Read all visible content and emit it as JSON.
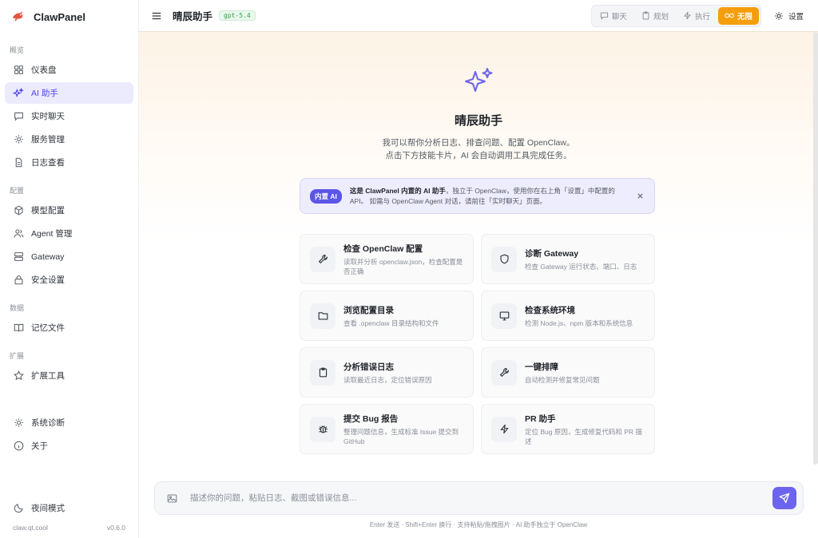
{
  "app": {
    "name": "ClawPanel",
    "version": "v0.6.0",
    "domain": "claw.qt.cool"
  },
  "sidebar": {
    "sections": [
      {
        "title": "概览",
        "items": [
          {
            "label": "仪表盘",
            "icon": "grid-icon"
          },
          {
            "label": "AI 助手",
            "icon": "sparkle-icon",
            "active": true
          },
          {
            "label": "实时聊天",
            "icon": "chat-icon"
          },
          {
            "label": "服务管理",
            "icon": "gear-icon"
          },
          {
            "label": "日志查看",
            "icon": "document-icon"
          }
        ]
      },
      {
        "title": "配置",
        "items": [
          {
            "label": "模型配置",
            "icon": "cube-icon"
          },
          {
            "label": "Agent 管理",
            "icon": "users-icon"
          },
          {
            "label": "Gateway",
            "icon": "server-icon"
          },
          {
            "label": "安全设置",
            "icon": "lock-icon"
          }
        ]
      },
      {
        "title": "数据",
        "items": [
          {
            "label": "记忆文件",
            "icon": "book-icon"
          }
        ]
      },
      {
        "title": "扩展",
        "items": [
          {
            "label": "扩展工具",
            "icon": "star-icon"
          }
        ]
      }
    ],
    "extra_items": [
      {
        "label": "系统诊断",
        "icon": "gear-icon"
      },
      {
        "label": "关于",
        "icon": "info-icon"
      }
    ],
    "night_mode_label": "夜间模式"
  },
  "topbar": {
    "title": "晴辰助手",
    "model": "gpt-5.4",
    "modes": [
      {
        "label": "聊天",
        "icon": "chat-icon"
      },
      {
        "label": "规划",
        "icon": "clipboard-icon"
      },
      {
        "label": "执行",
        "icon": "bolt-icon"
      },
      {
        "label": "无限",
        "icon": "infinity-icon",
        "active": true
      }
    ],
    "settings_label": "设置"
  },
  "hero": {
    "title": "晴辰助手",
    "line1": "我可以帮你分析日志、排查问题、配置 OpenClaw。",
    "line2": "点击下方技能卡片，AI 会自动调用工具完成任务。"
  },
  "notice": {
    "tag": "内置 AI",
    "bold": "这是 ClawPanel 内置的 AI 助手",
    "rest1": "，独立于 OpenClaw，使用你在右上角「设置」中配置的 API。",
    "rest2": "如需与 OpenClaw Agent 对话，请前往「实时聊天」页面。"
  },
  "cards": [
    {
      "title": "检查 OpenClaw 配置",
      "desc": "读取并分析 openclaw.json，检查配置是否正确",
      "icon": "wrench-icon"
    },
    {
      "title": "诊断 Gateway",
      "desc": "检查 Gateway 运行状态、端口、日志",
      "icon": "shield-icon"
    },
    {
      "title": "浏览配置目录",
      "desc": "查看 .openclaw 目录结构和文件",
      "icon": "folder-icon"
    },
    {
      "title": "检查系统环境",
      "desc": "检测 Node.js、npm 版本和系统信息",
      "icon": "monitor-icon"
    },
    {
      "title": "分析错误日志",
      "desc": "读取最近日志，定位错误原因",
      "icon": "clipboard-icon"
    },
    {
      "title": "一键排障",
      "desc": "自动检测并修复常见问题",
      "icon": "wrench-icon"
    },
    {
      "title": "提交 Bug 报告",
      "desc": "整理问题信息，生成标准 Issue 提交到 GitHub",
      "icon": "bug-icon"
    },
    {
      "title": "PR 助手",
      "desc": "定位 Bug 原因，生成修复代码和 PR 描述",
      "icon": "bolt-icon"
    }
  ],
  "composer": {
    "placeholder": "描述你的问题，粘贴日志、截图或错误信息...",
    "value": ""
  },
  "hint": "Enter 发送 · Shift+Enter 换行 · 支持粘贴/拖拽图片 · AI 助手独立于 OpenClaw",
  "colors": {
    "accent": "#5b55e8",
    "active_mode": "#f59e0b"
  }
}
